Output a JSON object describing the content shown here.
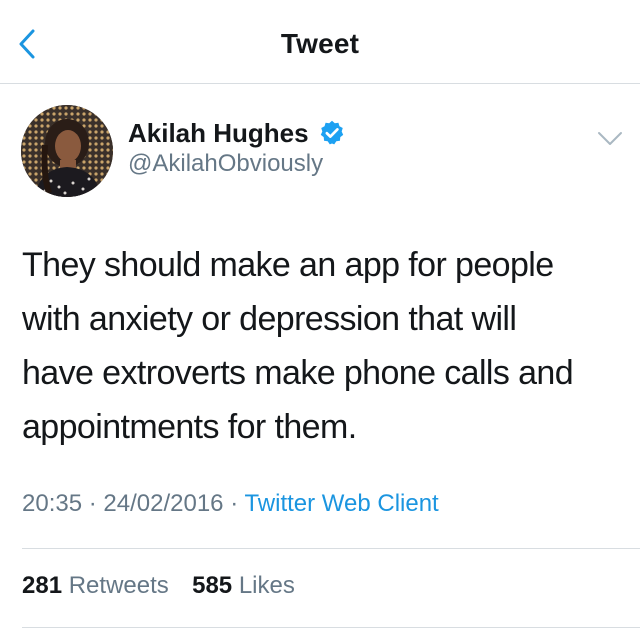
{
  "header": {
    "title": "Tweet",
    "back_icon": "chevron-left-icon"
  },
  "author": {
    "display_name": "Akilah Hughes",
    "handle": "@AkilahObviously",
    "verified": true,
    "verified_icon": "verified-badge-icon"
  },
  "tweet": {
    "text": "They should make an app for people\nwith anxiety or depression that will\nhave extroverts make phone calls and\nappointments for them.",
    "time": "20:35",
    "separator": "·",
    "date": "24/02/2016",
    "client": "Twitter Web Client"
  },
  "stats": {
    "retweets_count": "281",
    "retweets_label": "Retweets",
    "likes_count": "585",
    "likes_label": "Likes"
  },
  "colors": {
    "accent": "#1b95e0",
    "text_primary": "#14171a",
    "text_secondary": "#657786",
    "divider": "#d8dde1"
  }
}
